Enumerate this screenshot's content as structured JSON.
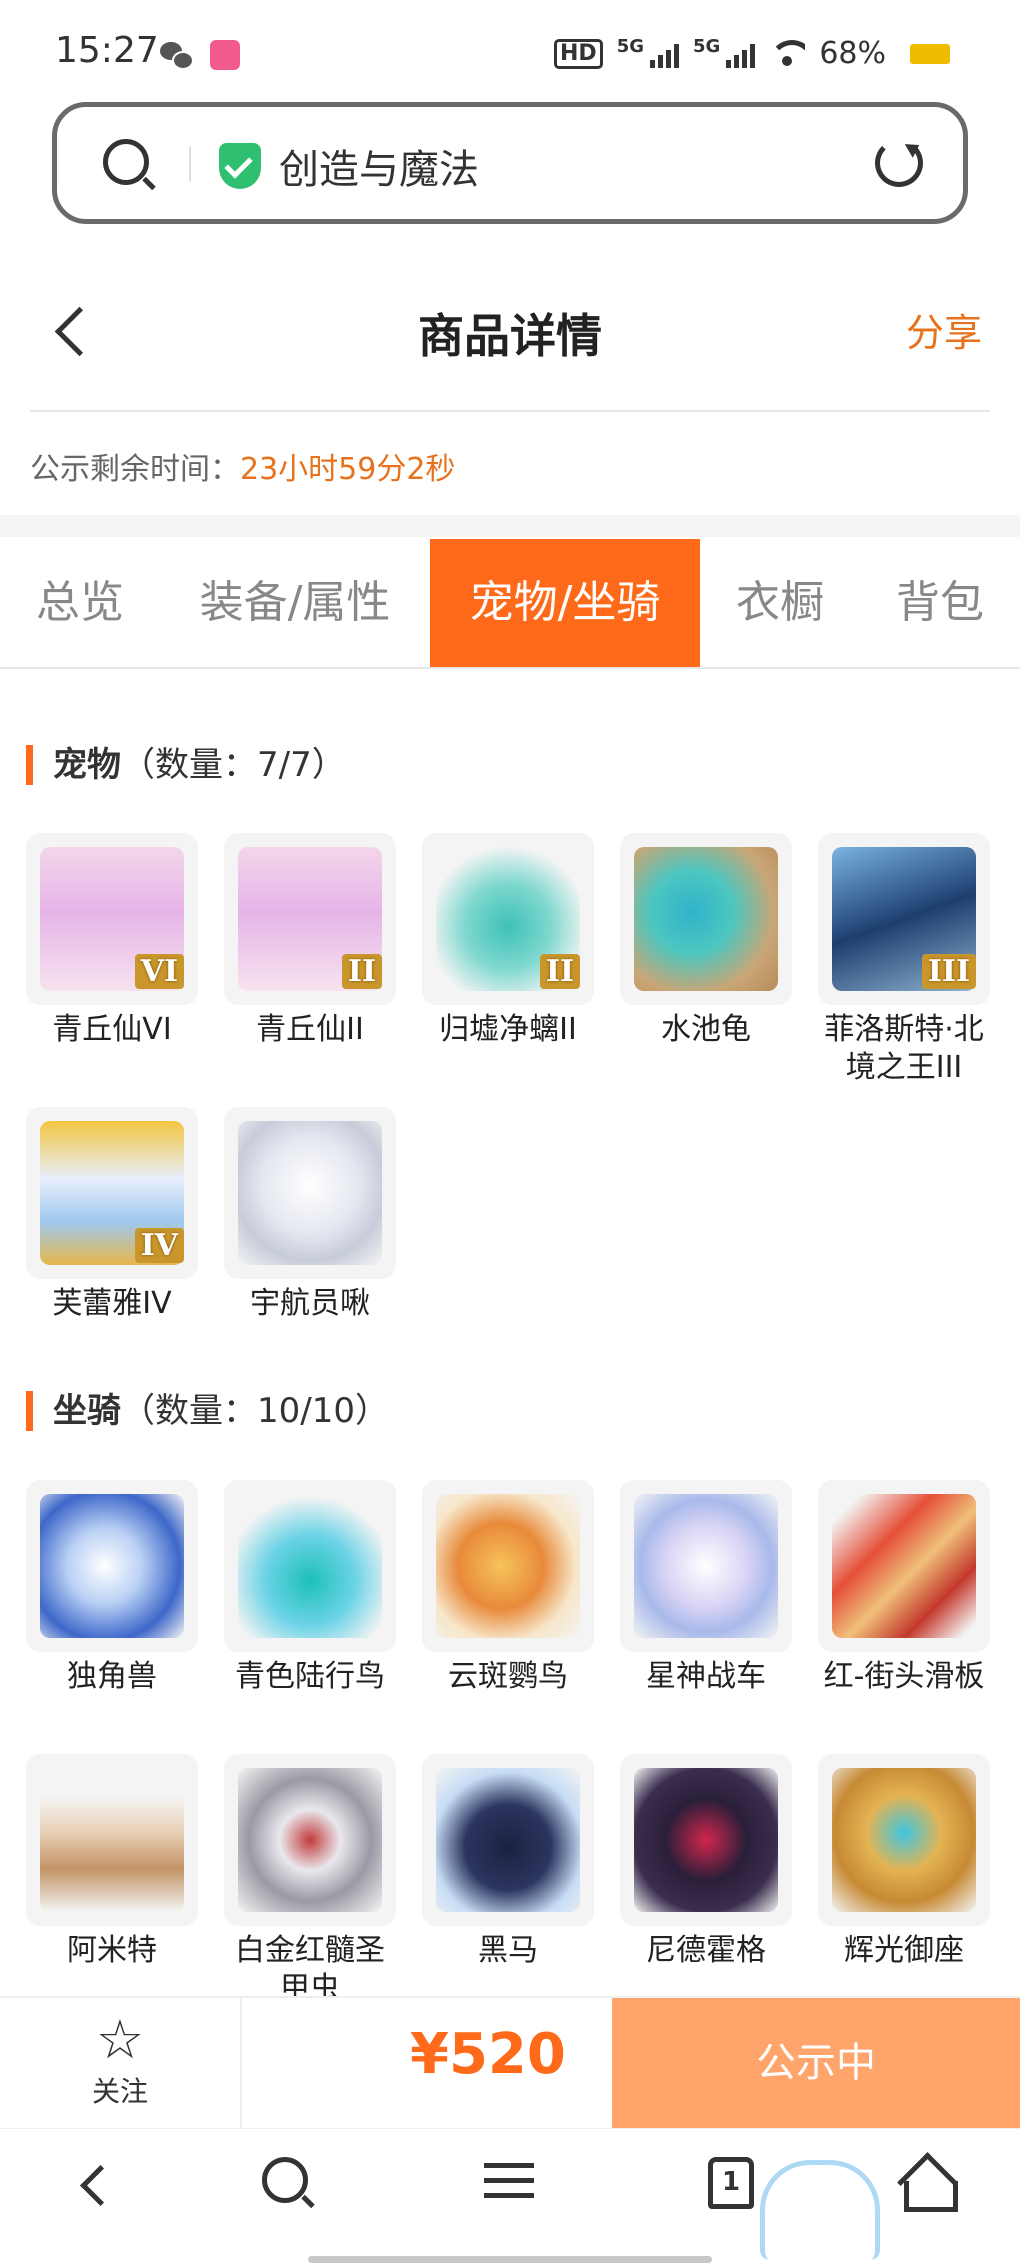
{
  "status_bar": {
    "time": "15:27",
    "hd": "HD",
    "network1": "5G",
    "network2": "5G",
    "battery": "68%"
  },
  "address_bar": {
    "text": "创造与魔法"
  },
  "header": {
    "title": "商品详情",
    "share": "分享"
  },
  "countdown": {
    "label": "公示剩余时间：",
    "value": "23小时59分2秒"
  },
  "tabs": [
    {
      "label": "总览",
      "active": false
    },
    {
      "label": "装备/属性",
      "active": false
    },
    {
      "label": "宠物/坐骑",
      "active": true
    },
    {
      "label": "衣橱",
      "active": false
    },
    {
      "label": "背包",
      "active": false
    }
  ],
  "pets": {
    "title": "宠物",
    "count": "（数量：7/7）",
    "items": [
      {
        "name": "青丘仙VI",
        "badge": "VI"
      },
      {
        "name": "青丘仙II",
        "badge": "II"
      },
      {
        "name": "归墟净螭II",
        "badge": "II"
      },
      {
        "name": "水池龟",
        "badge": ""
      },
      {
        "name": "菲洛斯特·北境之王III",
        "badge": "III"
      },
      {
        "name": "芙蕾雅IV",
        "badge": "IV"
      },
      {
        "name": "宇航员啾",
        "badge": ""
      }
    ]
  },
  "mounts": {
    "title": "坐骑",
    "count": "（数量：10/10）",
    "items": [
      {
        "name": "独角兽"
      },
      {
        "name": "青色陆行鸟"
      },
      {
        "name": "云斑鹦鸟"
      },
      {
        "name": "星神战车"
      },
      {
        "name": "红-街头滑板"
      },
      {
        "name": "阿米特"
      },
      {
        "name": "白金红髓圣甲虫"
      },
      {
        "name": "黑马"
      },
      {
        "name": "尼德霍格"
      },
      {
        "name": "辉光御座"
      }
    ]
  },
  "action_bar": {
    "follow": "关注",
    "price": "¥520",
    "status": "公示中"
  },
  "nav": {
    "tabs_count": "1"
  },
  "colors": {
    "accent": "#ff6a1a",
    "accent_light": "#ffa46a",
    "orange_text": "#e8721c"
  }
}
